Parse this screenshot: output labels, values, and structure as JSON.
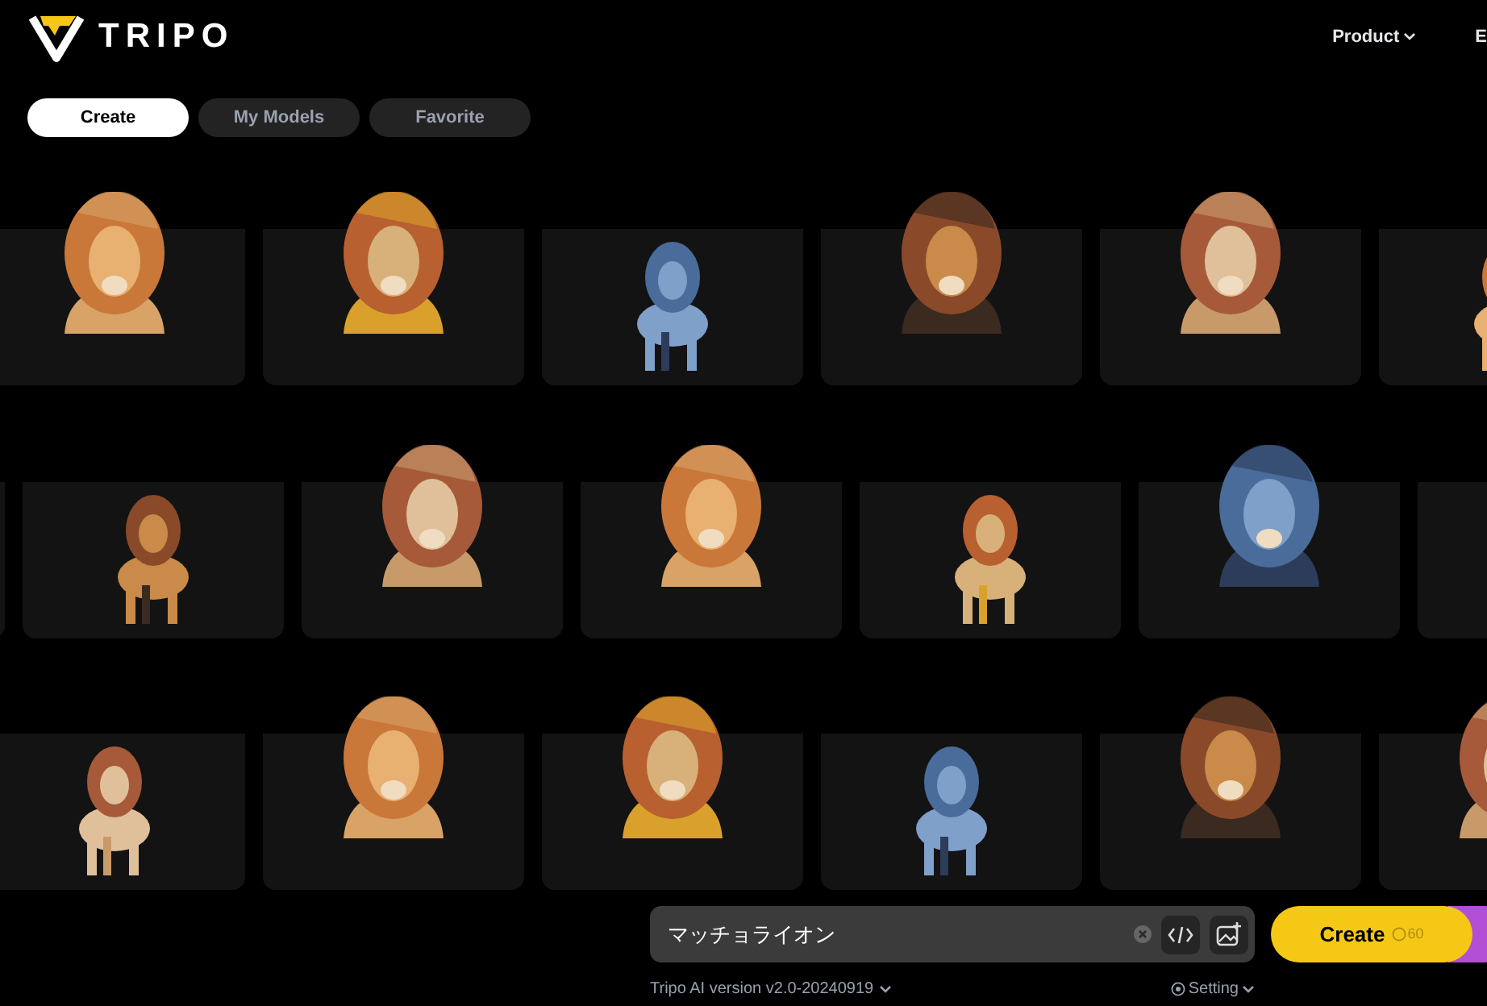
{
  "header": {
    "logo": "TRIPO",
    "nav": [
      {
        "label": "Product",
        "has_menu": true
      },
      {
        "label": "E",
        "has_menu": false
      }
    ]
  },
  "tabs": [
    {
      "label": "Create",
      "selected": true
    },
    {
      "label": "My Models",
      "selected": false
    },
    {
      "label": "Favorite",
      "selected": false
    }
  ],
  "gallery_rows": [
    {
      "cards": [
        {
          "kind": "picture"
        },
        {
          "kind": "picture"
        },
        {
          "kind": "picture"
        },
        {
          "kind": "picture"
        },
        {
          "kind": "picture"
        },
        {
          "kind": "picture"
        }
      ]
    },
    {
      "cards": [
        {
          "kind": "blank"
        },
        {
          "kind": "picture"
        },
        {
          "kind": "picture"
        },
        {
          "kind": "picture"
        },
        {
          "kind": "picture"
        },
        {
          "kind": "picture"
        },
        {
          "kind": "blank"
        }
      ]
    },
    {
      "cards": [
        {
          "kind": "picture"
        },
        {
          "kind": "picture"
        },
        {
          "kind": "picture"
        },
        {
          "kind": "picture"
        },
        {
          "kind": "picture"
        },
        {
          "kind": "picture"
        }
      ]
    }
  ],
  "prompt": {
    "value": "マッチョライオン"
  },
  "create_button": {
    "label": "Create",
    "cost": "60"
  },
  "footer": {
    "version": "Tripo AI version v2.0-20240919",
    "setting": "Setting"
  }
}
